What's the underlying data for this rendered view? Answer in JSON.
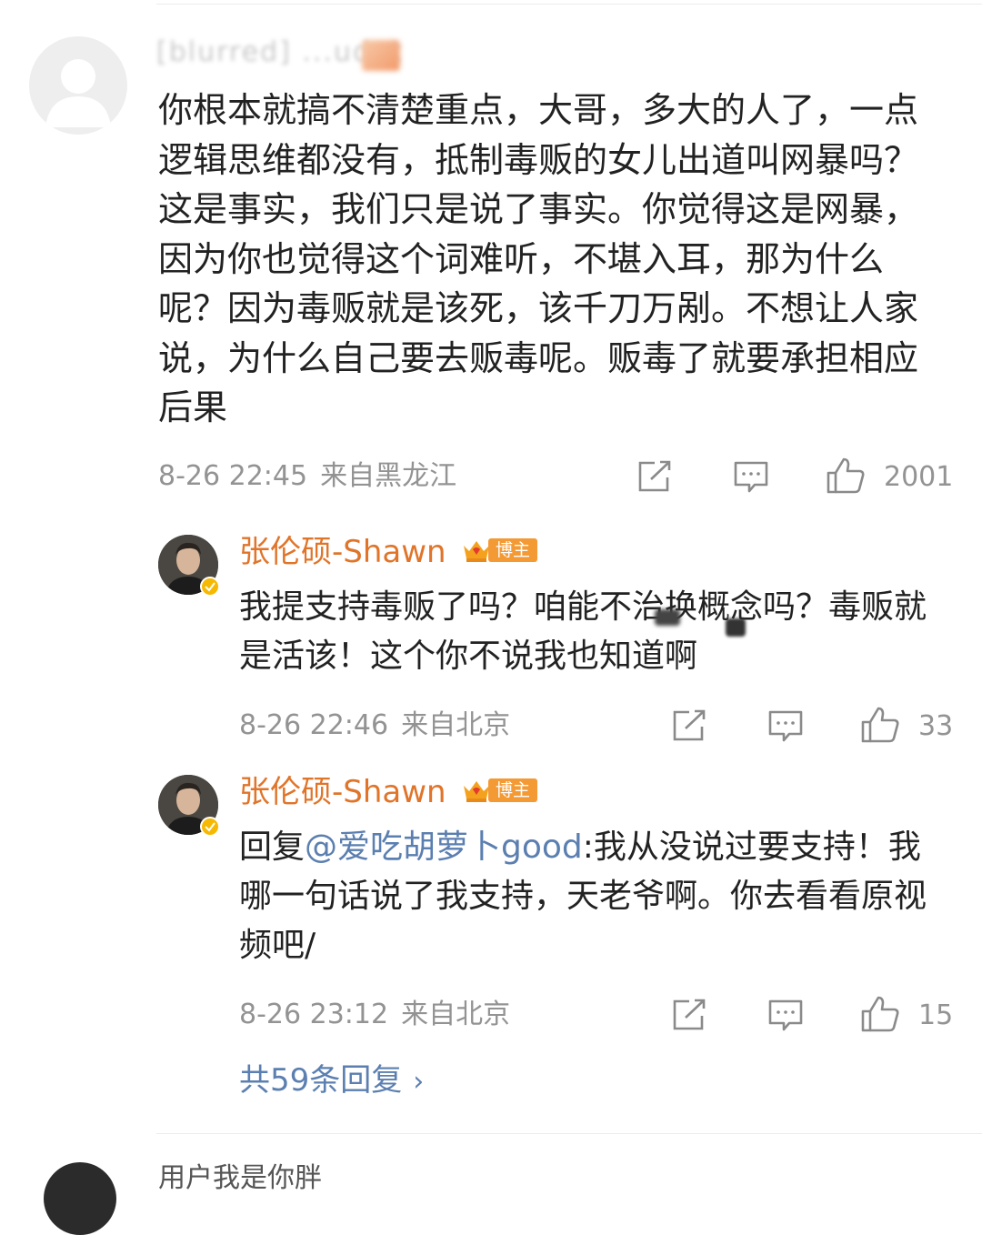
{
  "comment": {
    "username": "[blurred] ...udetit",
    "text": "你根本就搞不清楚重点，大哥，多大的人了，一点逻辑思维都没有，抵制毒贩的女儿出道叫网暴吗？这是事实，我们只是说了事实。你觉得这是网暴，因为你也觉得这个词难听，不堪入耳，那为什么呢？因为毒贩就是该死，该千刀万剐。不想让人家说，为什么自己要去贩毒呢。贩毒了就要承担相应后果",
    "time": "8-26 22:45",
    "location": "来自黑龙江",
    "likes": "2001",
    "icons": [
      "share-icon",
      "comment-icon",
      "like-icon"
    ]
  },
  "replies": [
    {
      "name": "张伦硕-Shawn",
      "badge": "博主",
      "text": "我提支持毒贩了吗？咱能不治换概念吗？毒贩就是活该！这个你不说我也知道啊",
      "time": "8-26 22:46",
      "location": "来自北京",
      "likes": "33"
    },
    {
      "name": "张伦硕-Shawn",
      "badge": "博主",
      "prefix": "回复",
      "mention": "@爱吃胡萝卜good",
      "text": ":我从没说过要支持！我哪一句话说了我支持，天老爷啊。你去看看原视频吧/",
      "time": "8-26 23:12",
      "location": "来自北京",
      "likes": "15"
    }
  ],
  "more_replies": "共59条回复",
  "next_comment": {
    "username": "用户我是你胖"
  },
  "colors": {
    "name_orange": "#e0752a",
    "link_blue": "#5b7fb0",
    "meta_gray": "#939393",
    "badge_orange": "#f39a35",
    "verified_gold": "#f6b800"
  }
}
